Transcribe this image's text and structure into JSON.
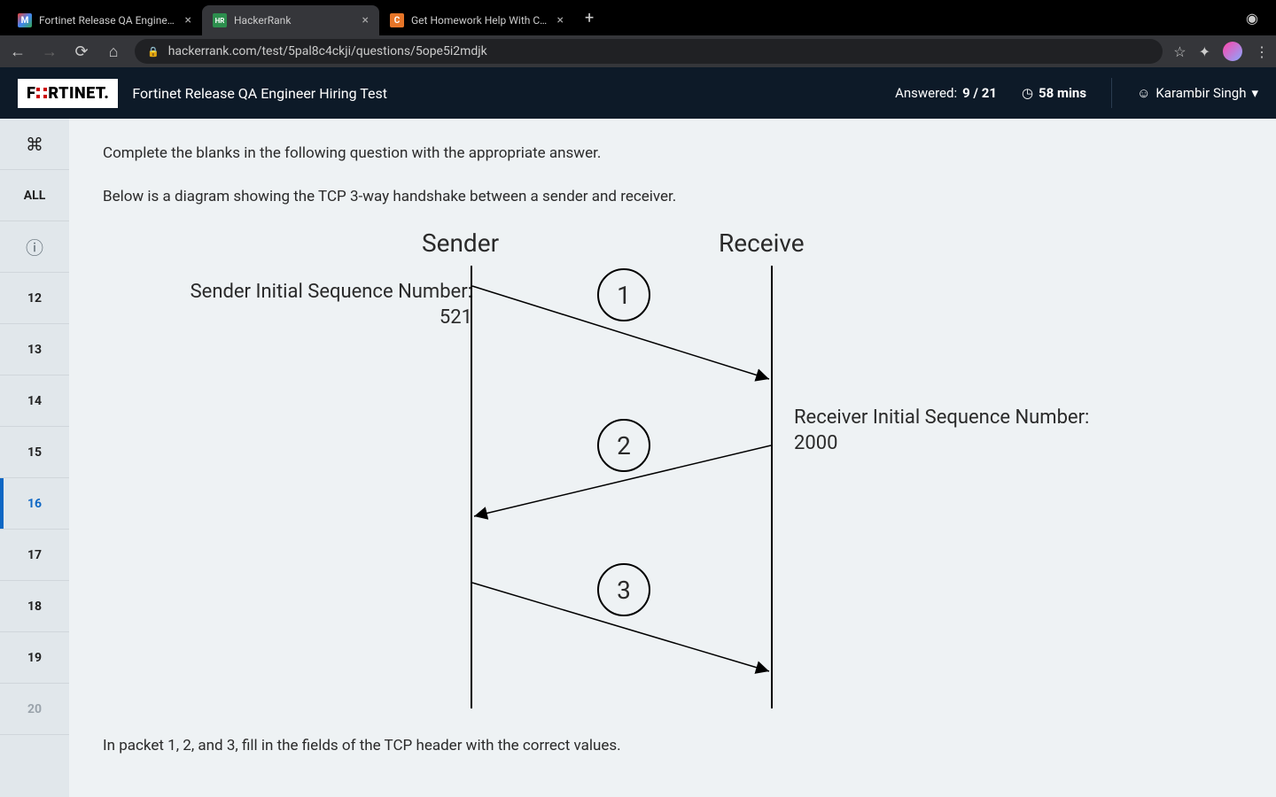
{
  "browser": {
    "tabs": [
      {
        "title": "Fortinet Release QA Engineer H",
        "favicon": "M",
        "favcolor": "transparent",
        "favtext": "linear"
      },
      {
        "title": "HackerRank",
        "favicon": "HR",
        "favcolor": "#2d8f4e"
      },
      {
        "title": "Get Homework Help With Cheg",
        "favicon": "C",
        "favcolor": "#e77528"
      }
    ],
    "active_tab": 1,
    "url": "hackerrank.com/test/5pal8c4ckji/questions/5ope5i2mdjk"
  },
  "header": {
    "logo_text_pre": "F",
    "logo_text_post": "RTINET.",
    "test_title": "Fortinet Release QA Engineer Hiring Test",
    "answered_label": "Answered:",
    "answered_value": "9 / 21",
    "time_value": "58 mins",
    "user_name": "Karambir Singh"
  },
  "sidebar": {
    "cmd_icon": "⌘",
    "all_label": "ALL",
    "info_icon": "ⓘ",
    "items": [
      "12",
      "13",
      "14",
      "15",
      "16",
      "17",
      "18",
      "19",
      "20"
    ],
    "active": "16",
    "muted": [
      "20"
    ]
  },
  "question": {
    "instruction": "Complete the blanks in the following question with the appropriate answer.",
    "description": "Below is a diagram showing the TCP 3-way handshake between a sender and receiver.",
    "sender_title": "Sender",
    "receiver_title": "Receive",
    "sender_seq_label": "Sender Initial Sequence Number:",
    "sender_seq_value": "521",
    "receiver_seq_label": "Receiver Initial Sequence Number:",
    "receiver_seq_value": "2000",
    "packets": [
      "1",
      "2",
      "3"
    ],
    "footer": "In packet 1, 2, and 3, fill in the fields of the TCP header with the correct values."
  }
}
